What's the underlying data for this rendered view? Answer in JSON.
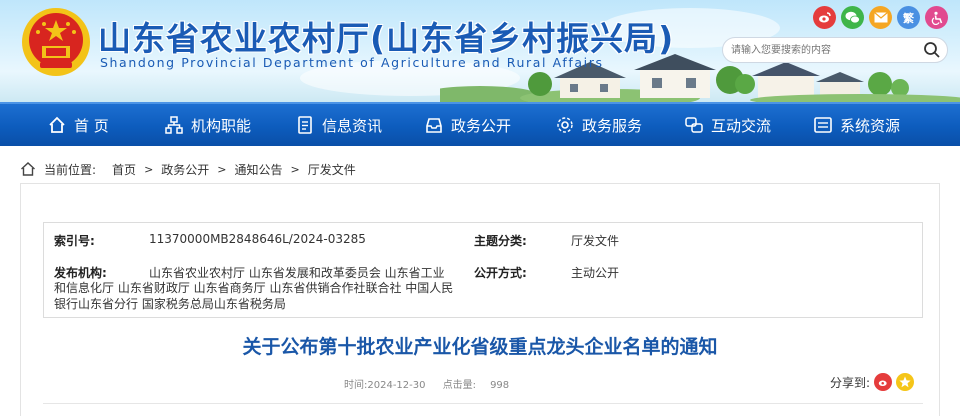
{
  "header": {
    "title": "山东省农业农村厅(山东省乡村振兴局)",
    "subtitle": "Shandong Provincial Department of Agriculture and Rural Affairs",
    "search_placeholder": "请输入您要搜索的内容",
    "share_icons": [
      "weibo-icon",
      "wechat-icon",
      "email-icon",
      "traditional-chinese-icon",
      "accessibility-icon"
    ],
    "traditional_label": "繁",
    "colors": {
      "title": "#1a5bb5",
      "emblem_red": "#d8251f",
      "emblem_gold": "#f3c318"
    }
  },
  "nav": {
    "items": [
      {
        "label": "首 页",
        "icon": "home-icon"
      },
      {
        "label": "机构职能",
        "icon": "org-chart-icon"
      },
      {
        "label": "信息资讯",
        "icon": "document-icon"
      },
      {
        "label": "政务公开",
        "icon": "inbox-icon"
      },
      {
        "label": "政务服务",
        "icon": "service-icon"
      },
      {
        "label": "互动交流",
        "icon": "interaction-icon"
      },
      {
        "label": "系统资源",
        "icon": "system-icon"
      }
    ],
    "colors": {
      "bar": "#0d5cbd"
    }
  },
  "breadcrumb": {
    "label": "当前位置:",
    "items": [
      "首页",
      "政务公开",
      "通知公告",
      "厅发文件"
    ],
    "separator": ">"
  },
  "meta": {
    "index_label": "索引号:",
    "index_value": "11370000MB2848646L/2024-03285",
    "topic_label": "主题分类:",
    "topic_value": "厅发文件",
    "issuer_label": "发布机构:",
    "issuer_value_line1": "山东省农业农村厅 山东省发展和改革委员会 山东省工业",
    "issuer_value_rest": "和信息化厅 山东省财政厅 山东省商务厅 山东省供销合作社联合社 中国人民银行山东省分行 国家税务总局山东省税务局",
    "public_label": "公开方式:",
    "public_value": "主动公开"
  },
  "article": {
    "title": "关于公布第十批农业产业化省级重点龙头企业名单的通知",
    "time_label": "时间:",
    "time_value": "2024-12-30",
    "hits_label": "点击量:",
    "hits_value": "998",
    "share_label": "分享到:",
    "share_icons": [
      "weibo-icon",
      "qzone-icon"
    ]
  }
}
